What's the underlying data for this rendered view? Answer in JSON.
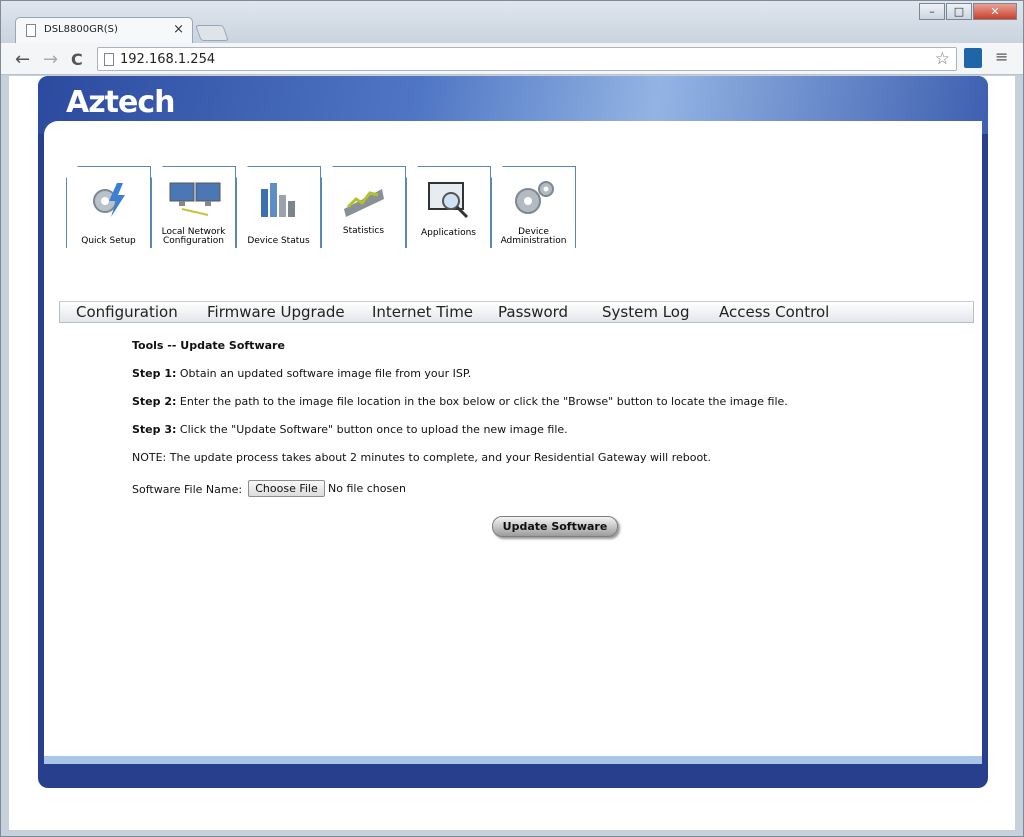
{
  "browser": {
    "tab_title": "DSL8800GR(S)",
    "tab_close": "×",
    "url": "192.168.1.254",
    "nav": {
      "back": "←",
      "forward": "→",
      "reload": "C"
    },
    "star": "☆",
    "menu": "≡",
    "window_buttons": {
      "minimize": "–",
      "maximize": "□",
      "close": "✕"
    }
  },
  "header": {
    "logo": "Aztech"
  },
  "icons": [
    {
      "name": "quick-setup",
      "label": "Quick Setup",
      "icon": "gear-lightning-icon"
    },
    {
      "name": "local-network-configuration",
      "label": "Local Network Configuration",
      "icon": "monitors-icon"
    },
    {
      "name": "device-status",
      "label": "Device Status",
      "icon": "bar-chart-icon"
    },
    {
      "name": "statistics",
      "label": "Statistics",
      "icon": "graph-ribbon-icon"
    },
    {
      "name": "applications",
      "label": "Applications",
      "icon": "magnifier-screen-icon"
    },
    {
      "name": "device-administration",
      "label": "Device Administration",
      "icon": "gears-icon"
    }
  ],
  "subnav": [
    "Configuration",
    "Firmware Upgrade",
    "Internet Time",
    "Password",
    "System Log",
    "Access Control"
  ],
  "content": {
    "heading": "Tools -- Update Software",
    "step1_label": "Step 1:",
    "step1_text": " Obtain an updated software image file from your ISP.",
    "step2_label": "Step 2:",
    "step2_text": " Enter the path to the image file location in the box below or click the \"Browse\" button to locate the image file.",
    "step3_label": "Step 3:",
    "step3_text": " Click the \"Update Software\" button once to upload the new image file.",
    "note": "NOTE: The update process takes about 2 minutes to complete, and your Residential Gateway will reboot.",
    "file_label": "Software File Name:",
    "choose_file": "Choose File",
    "no_file": "No file chosen",
    "update_button": "Update Software"
  },
  "colors": {
    "brand_blue": "#273f8c",
    "header_light": "#93b4e3",
    "icon_border": "#5a86b8"
  }
}
